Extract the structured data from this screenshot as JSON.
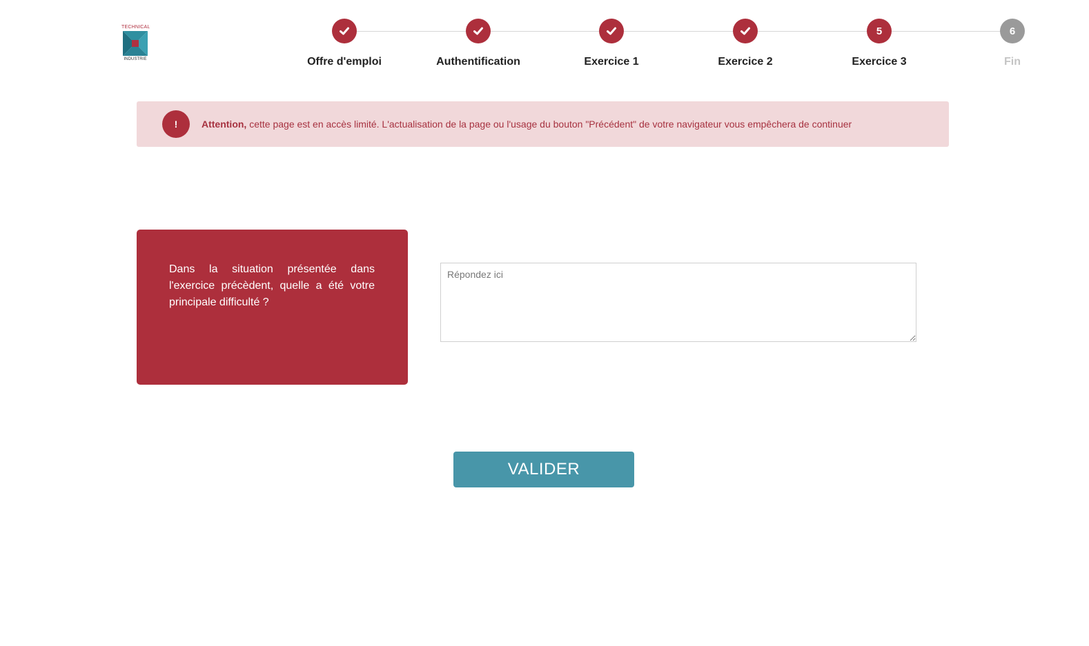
{
  "logo": {
    "top_text": "TECHNICAL",
    "bottom_text": "INDUSTRIE",
    "colors": {
      "red": "#b03040",
      "teal": "#2f8fa0",
      "dark_teal": "#1f6f80"
    }
  },
  "stepper": {
    "steps": [
      {
        "number": "1",
        "label": "Offre d'emploi",
        "state": "done"
      },
      {
        "number": "2",
        "label": "Authentification",
        "state": "done"
      },
      {
        "number": "3",
        "label": "Exercice 1",
        "state": "done"
      },
      {
        "number": "4",
        "label": "Exercice 2",
        "state": "done"
      },
      {
        "number": "5",
        "label": "Exercice 3",
        "state": "active"
      },
      {
        "number": "6",
        "label": "Fin",
        "state": "pending"
      }
    ],
    "done_icon": "check-icon"
  },
  "alert": {
    "icon_text": "!",
    "strong": "Attention,",
    "message": " cette page est en accès limité. L'actualisation de la page ou l'usage du bouton \"Précédent\" de votre navigateur vous empêchera de continuer"
  },
  "question": {
    "text": "Dans la situation présentée dans l'exercice précèdent, quelle a été votre principale difficulté ?"
  },
  "answer": {
    "placeholder": "Répondez ici",
    "value": ""
  },
  "submit": {
    "label": "VALIDER"
  },
  "colors": {
    "primary_red": "#ad2f3c",
    "alert_bg": "#f1d8da",
    "button_teal": "#4896a9",
    "pending_grey": "#9a9a9a"
  }
}
